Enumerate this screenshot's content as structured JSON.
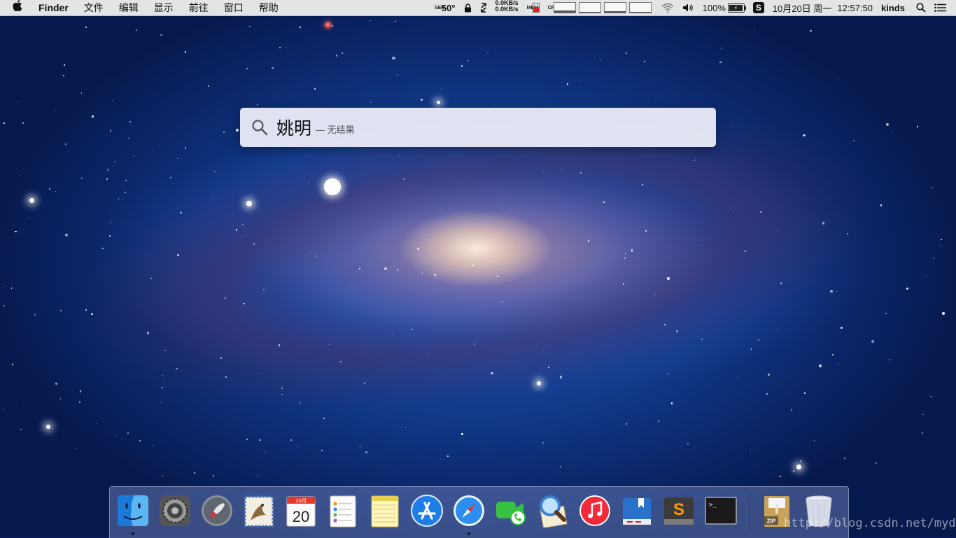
{
  "menubar": {
    "apple_glyph": "",
    "app_name": "Finder",
    "menus": [
      "文件",
      "编辑",
      "显示",
      "前往",
      "窗口",
      "帮助"
    ],
    "temp_label": "SEN",
    "temperature": "50°",
    "net_up": "0.0KB/s",
    "net_down": "0.0KB/s",
    "mem_label": "MEM",
    "cpu_label": "CPU",
    "battery_percent": "100%",
    "date": "10月20日 周一",
    "time": "12:57:50",
    "user": "kinds"
  },
  "spotlight": {
    "query": "姚明",
    "status": "— 无结果"
  },
  "dock": {
    "apps": [
      {
        "name": "finder-icon",
        "running": true
      },
      {
        "name": "system-preferences-icon",
        "running": false
      },
      {
        "name": "launchpad-icon",
        "running": false
      },
      {
        "name": "mail-icon",
        "running": false
      },
      {
        "name": "calendar-icon",
        "running": false,
        "month": "10月",
        "day": "20"
      },
      {
        "name": "reminders-icon",
        "running": false
      },
      {
        "name": "notes-icon",
        "running": false
      },
      {
        "name": "app-store-icon",
        "running": false
      },
      {
        "name": "safari-icon",
        "running": true
      },
      {
        "name": "facetime-icon",
        "running": false
      },
      {
        "name": "preview-icon",
        "running": false
      },
      {
        "name": "itunes-icon",
        "running": false
      },
      {
        "name": "dictionary-icon",
        "running": false
      },
      {
        "name": "sublime-text-icon",
        "running": false
      },
      {
        "name": "terminal-icon",
        "running": false
      },
      {
        "name": "zip-archive-icon",
        "running": false
      },
      {
        "name": "trash-icon",
        "running": false
      }
    ],
    "calendar_month": "10月",
    "calendar_day": "20",
    "sublime_letter": "S",
    "terminal_prompt": ">_",
    "zip_label": "ZIP"
  },
  "watermark": "http://blog.csdn.net/mydo",
  "colors": {
    "menubar_bg": "#ececec",
    "dock_bg": "#788cc8",
    "wallpaper_deep": "#0a2566"
  }
}
